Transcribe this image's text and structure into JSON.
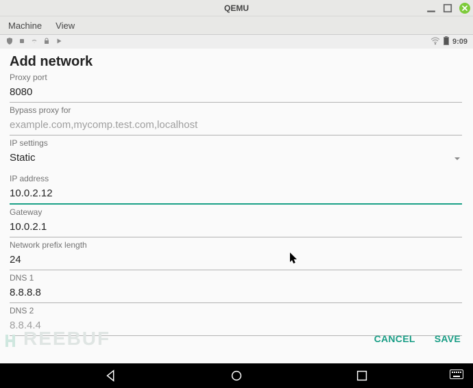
{
  "window": {
    "title": "QEMU",
    "menubar": {
      "machine": "Machine",
      "view": "View"
    }
  },
  "statusbar": {
    "time": "9:09"
  },
  "page": {
    "title": "Add network",
    "fields": {
      "proxy_port": {
        "label": "Proxy port",
        "value": "8080"
      },
      "bypass_proxy": {
        "label": "Bypass proxy for",
        "placeholder": "example.com,mycomp.test.com,localhost"
      },
      "ip_settings": {
        "label": "IP settings",
        "value": "Static"
      },
      "ip_address": {
        "label": "IP address",
        "value": "10.0.2.12"
      },
      "gateway": {
        "label": "Gateway",
        "value": "10.0.2.1"
      },
      "prefix_len": {
        "label": "Network prefix length",
        "value": "24"
      },
      "dns1": {
        "label": "DNS 1",
        "value": "8.8.8.8"
      },
      "dns2": {
        "label": "DNS 2",
        "placeholder": "8.8.4.4"
      }
    },
    "actions": {
      "cancel": "CANCEL",
      "save": "SAVE"
    }
  },
  "colors": {
    "accent": "#1a9e86"
  }
}
